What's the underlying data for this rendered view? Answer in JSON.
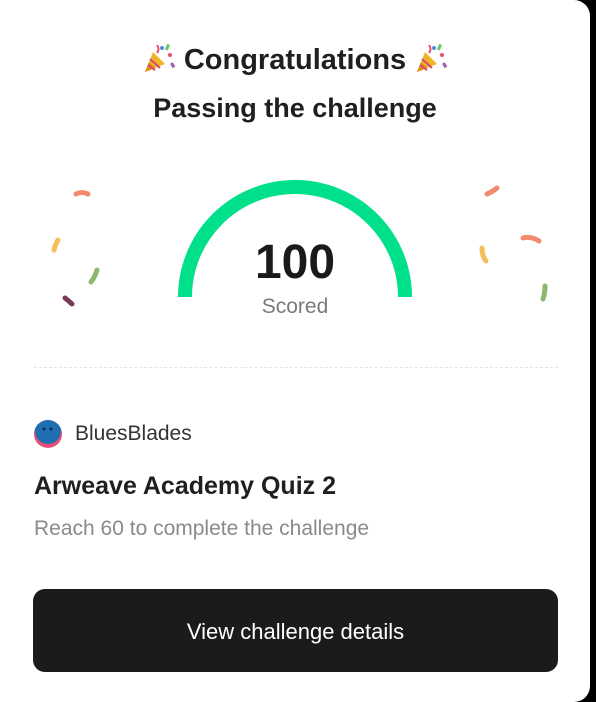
{
  "header": {
    "title": "Congratulations",
    "subtitle": "Passing the challenge",
    "icon": "party-popper-icon"
  },
  "score": {
    "value": "100",
    "label": "Scored",
    "fraction": 1.0,
    "color": "#00e08a"
  },
  "challenge": {
    "author": "BluesBlades",
    "title": "Arweave Academy Quiz 2",
    "description": "Reach 60 to complete the challenge"
  },
  "actions": {
    "view_details_label": "View challenge details"
  },
  "colors": {
    "button_bg": "#1b1b1b",
    "gauge": "#00e08a",
    "confetti": [
      "#f28b6e",
      "#f5c05a",
      "#8cb86e",
      "#7a3a55"
    ]
  }
}
